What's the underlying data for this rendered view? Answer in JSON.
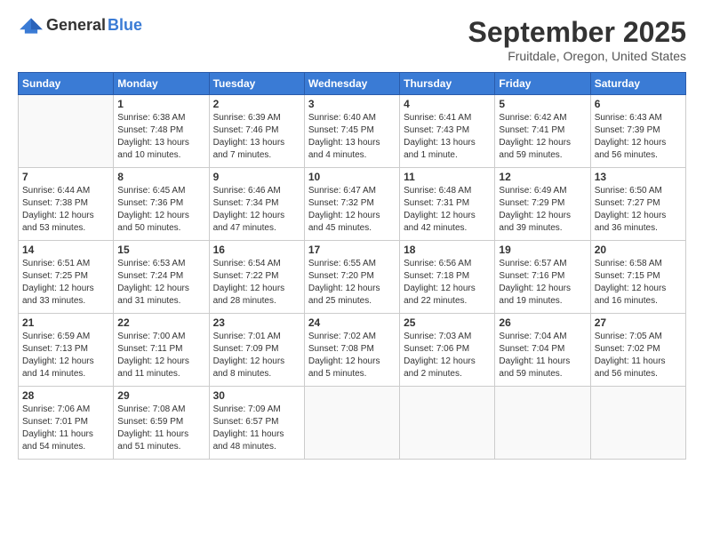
{
  "header": {
    "logo_general": "General",
    "logo_blue": "Blue",
    "month_title": "September 2025",
    "location": "Fruitdale, Oregon, United States"
  },
  "weekdays": [
    "Sunday",
    "Monday",
    "Tuesday",
    "Wednesday",
    "Thursday",
    "Friday",
    "Saturday"
  ],
  "weeks": [
    [
      {
        "day": "",
        "sunrise": "",
        "sunset": "",
        "daylight": ""
      },
      {
        "day": "1",
        "sunrise": "Sunrise: 6:38 AM",
        "sunset": "Sunset: 7:48 PM",
        "daylight": "Daylight: 13 hours and 10 minutes."
      },
      {
        "day": "2",
        "sunrise": "Sunrise: 6:39 AM",
        "sunset": "Sunset: 7:46 PM",
        "daylight": "Daylight: 13 hours and 7 minutes."
      },
      {
        "day": "3",
        "sunrise": "Sunrise: 6:40 AM",
        "sunset": "Sunset: 7:45 PM",
        "daylight": "Daylight: 13 hours and 4 minutes."
      },
      {
        "day": "4",
        "sunrise": "Sunrise: 6:41 AM",
        "sunset": "Sunset: 7:43 PM",
        "daylight": "Daylight: 13 hours and 1 minute."
      },
      {
        "day": "5",
        "sunrise": "Sunrise: 6:42 AM",
        "sunset": "Sunset: 7:41 PM",
        "daylight": "Daylight: 12 hours and 59 minutes."
      },
      {
        "day": "6",
        "sunrise": "Sunrise: 6:43 AM",
        "sunset": "Sunset: 7:39 PM",
        "daylight": "Daylight: 12 hours and 56 minutes."
      }
    ],
    [
      {
        "day": "7",
        "sunrise": "Sunrise: 6:44 AM",
        "sunset": "Sunset: 7:38 PM",
        "daylight": "Daylight: 12 hours and 53 minutes."
      },
      {
        "day": "8",
        "sunrise": "Sunrise: 6:45 AM",
        "sunset": "Sunset: 7:36 PM",
        "daylight": "Daylight: 12 hours and 50 minutes."
      },
      {
        "day": "9",
        "sunrise": "Sunrise: 6:46 AM",
        "sunset": "Sunset: 7:34 PM",
        "daylight": "Daylight: 12 hours and 47 minutes."
      },
      {
        "day": "10",
        "sunrise": "Sunrise: 6:47 AM",
        "sunset": "Sunset: 7:32 PM",
        "daylight": "Daylight: 12 hours and 45 minutes."
      },
      {
        "day": "11",
        "sunrise": "Sunrise: 6:48 AM",
        "sunset": "Sunset: 7:31 PM",
        "daylight": "Daylight: 12 hours and 42 minutes."
      },
      {
        "day": "12",
        "sunrise": "Sunrise: 6:49 AM",
        "sunset": "Sunset: 7:29 PM",
        "daylight": "Daylight: 12 hours and 39 minutes."
      },
      {
        "day": "13",
        "sunrise": "Sunrise: 6:50 AM",
        "sunset": "Sunset: 7:27 PM",
        "daylight": "Daylight: 12 hours and 36 minutes."
      }
    ],
    [
      {
        "day": "14",
        "sunrise": "Sunrise: 6:51 AM",
        "sunset": "Sunset: 7:25 PM",
        "daylight": "Daylight: 12 hours and 33 minutes."
      },
      {
        "day": "15",
        "sunrise": "Sunrise: 6:53 AM",
        "sunset": "Sunset: 7:24 PM",
        "daylight": "Daylight: 12 hours and 31 minutes."
      },
      {
        "day": "16",
        "sunrise": "Sunrise: 6:54 AM",
        "sunset": "Sunset: 7:22 PM",
        "daylight": "Daylight: 12 hours and 28 minutes."
      },
      {
        "day": "17",
        "sunrise": "Sunrise: 6:55 AM",
        "sunset": "Sunset: 7:20 PM",
        "daylight": "Daylight: 12 hours and 25 minutes."
      },
      {
        "day": "18",
        "sunrise": "Sunrise: 6:56 AM",
        "sunset": "Sunset: 7:18 PM",
        "daylight": "Daylight: 12 hours and 22 minutes."
      },
      {
        "day": "19",
        "sunrise": "Sunrise: 6:57 AM",
        "sunset": "Sunset: 7:16 PM",
        "daylight": "Daylight: 12 hours and 19 minutes."
      },
      {
        "day": "20",
        "sunrise": "Sunrise: 6:58 AM",
        "sunset": "Sunset: 7:15 PM",
        "daylight": "Daylight: 12 hours and 16 minutes."
      }
    ],
    [
      {
        "day": "21",
        "sunrise": "Sunrise: 6:59 AM",
        "sunset": "Sunset: 7:13 PM",
        "daylight": "Daylight: 12 hours and 14 minutes."
      },
      {
        "day": "22",
        "sunrise": "Sunrise: 7:00 AM",
        "sunset": "Sunset: 7:11 PM",
        "daylight": "Daylight: 12 hours and 11 minutes."
      },
      {
        "day": "23",
        "sunrise": "Sunrise: 7:01 AM",
        "sunset": "Sunset: 7:09 PM",
        "daylight": "Daylight: 12 hours and 8 minutes."
      },
      {
        "day": "24",
        "sunrise": "Sunrise: 7:02 AM",
        "sunset": "Sunset: 7:08 PM",
        "daylight": "Daylight: 12 hours and 5 minutes."
      },
      {
        "day": "25",
        "sunrise": "Sunrise: 7:03 AM",
        "sunset": "Sunset: 7:06 PM",
        "daylight": "Daylight: 12 hours and 2 minutes."
      },
      {
        "day": "26",
        "sunrise": "Sunrise: 7:04 AM",
        "sunset": "Sunset: 7:04 PM",
        "daylight": "Daylight: 11 hours and 59 minutes."
      },
      {
        "day": "27",
        "sunrise": "Sunrise: 7:05 AM",
        "sunset": "Sunset: 7:02 PM",
        "daylight": "Daylight: 11 hours and 56 minutes."
      }
    ],
    [
      {
        "day": "28",
        "sunrise": "Sunrise: 7:06 AM",
        "sunset": "Sunset: 7:01 PM",
        "daylight": "Daylight: 11 hours and 54 minutes."
      },
      {
        "day": "29",
        "sunrise": "Sunrise: 7:08 AM",
        "sunset": "Sunset: 6:59 PM",
        "daylight": "Daylight: 11 hours and 51 minutes."
      },
      {
        "day": "30",
        "sunrise": "Sunrise: 7:09 AM",
        "sunset": "Sunset: 6:57 PM",
        "daylight": "Daylight: 11 hours and 48 minutes."
      },
      {
        "day": "",
        "sunrise": "",
        "sunset": "",
        "daylight": ""
      },
      {
        "day": "",
        "sunrise": "",
        "sunset": "",
        "daylight": ""
      },
      {
        "day": "",
        "sunrise": "",
        "sunset": "",
        "daylight": ""
      },
      {
        "day": "",
        "sunrise": "",
        "sunset": "",
        "daylight": ""
      }
    ]
  ]
}
